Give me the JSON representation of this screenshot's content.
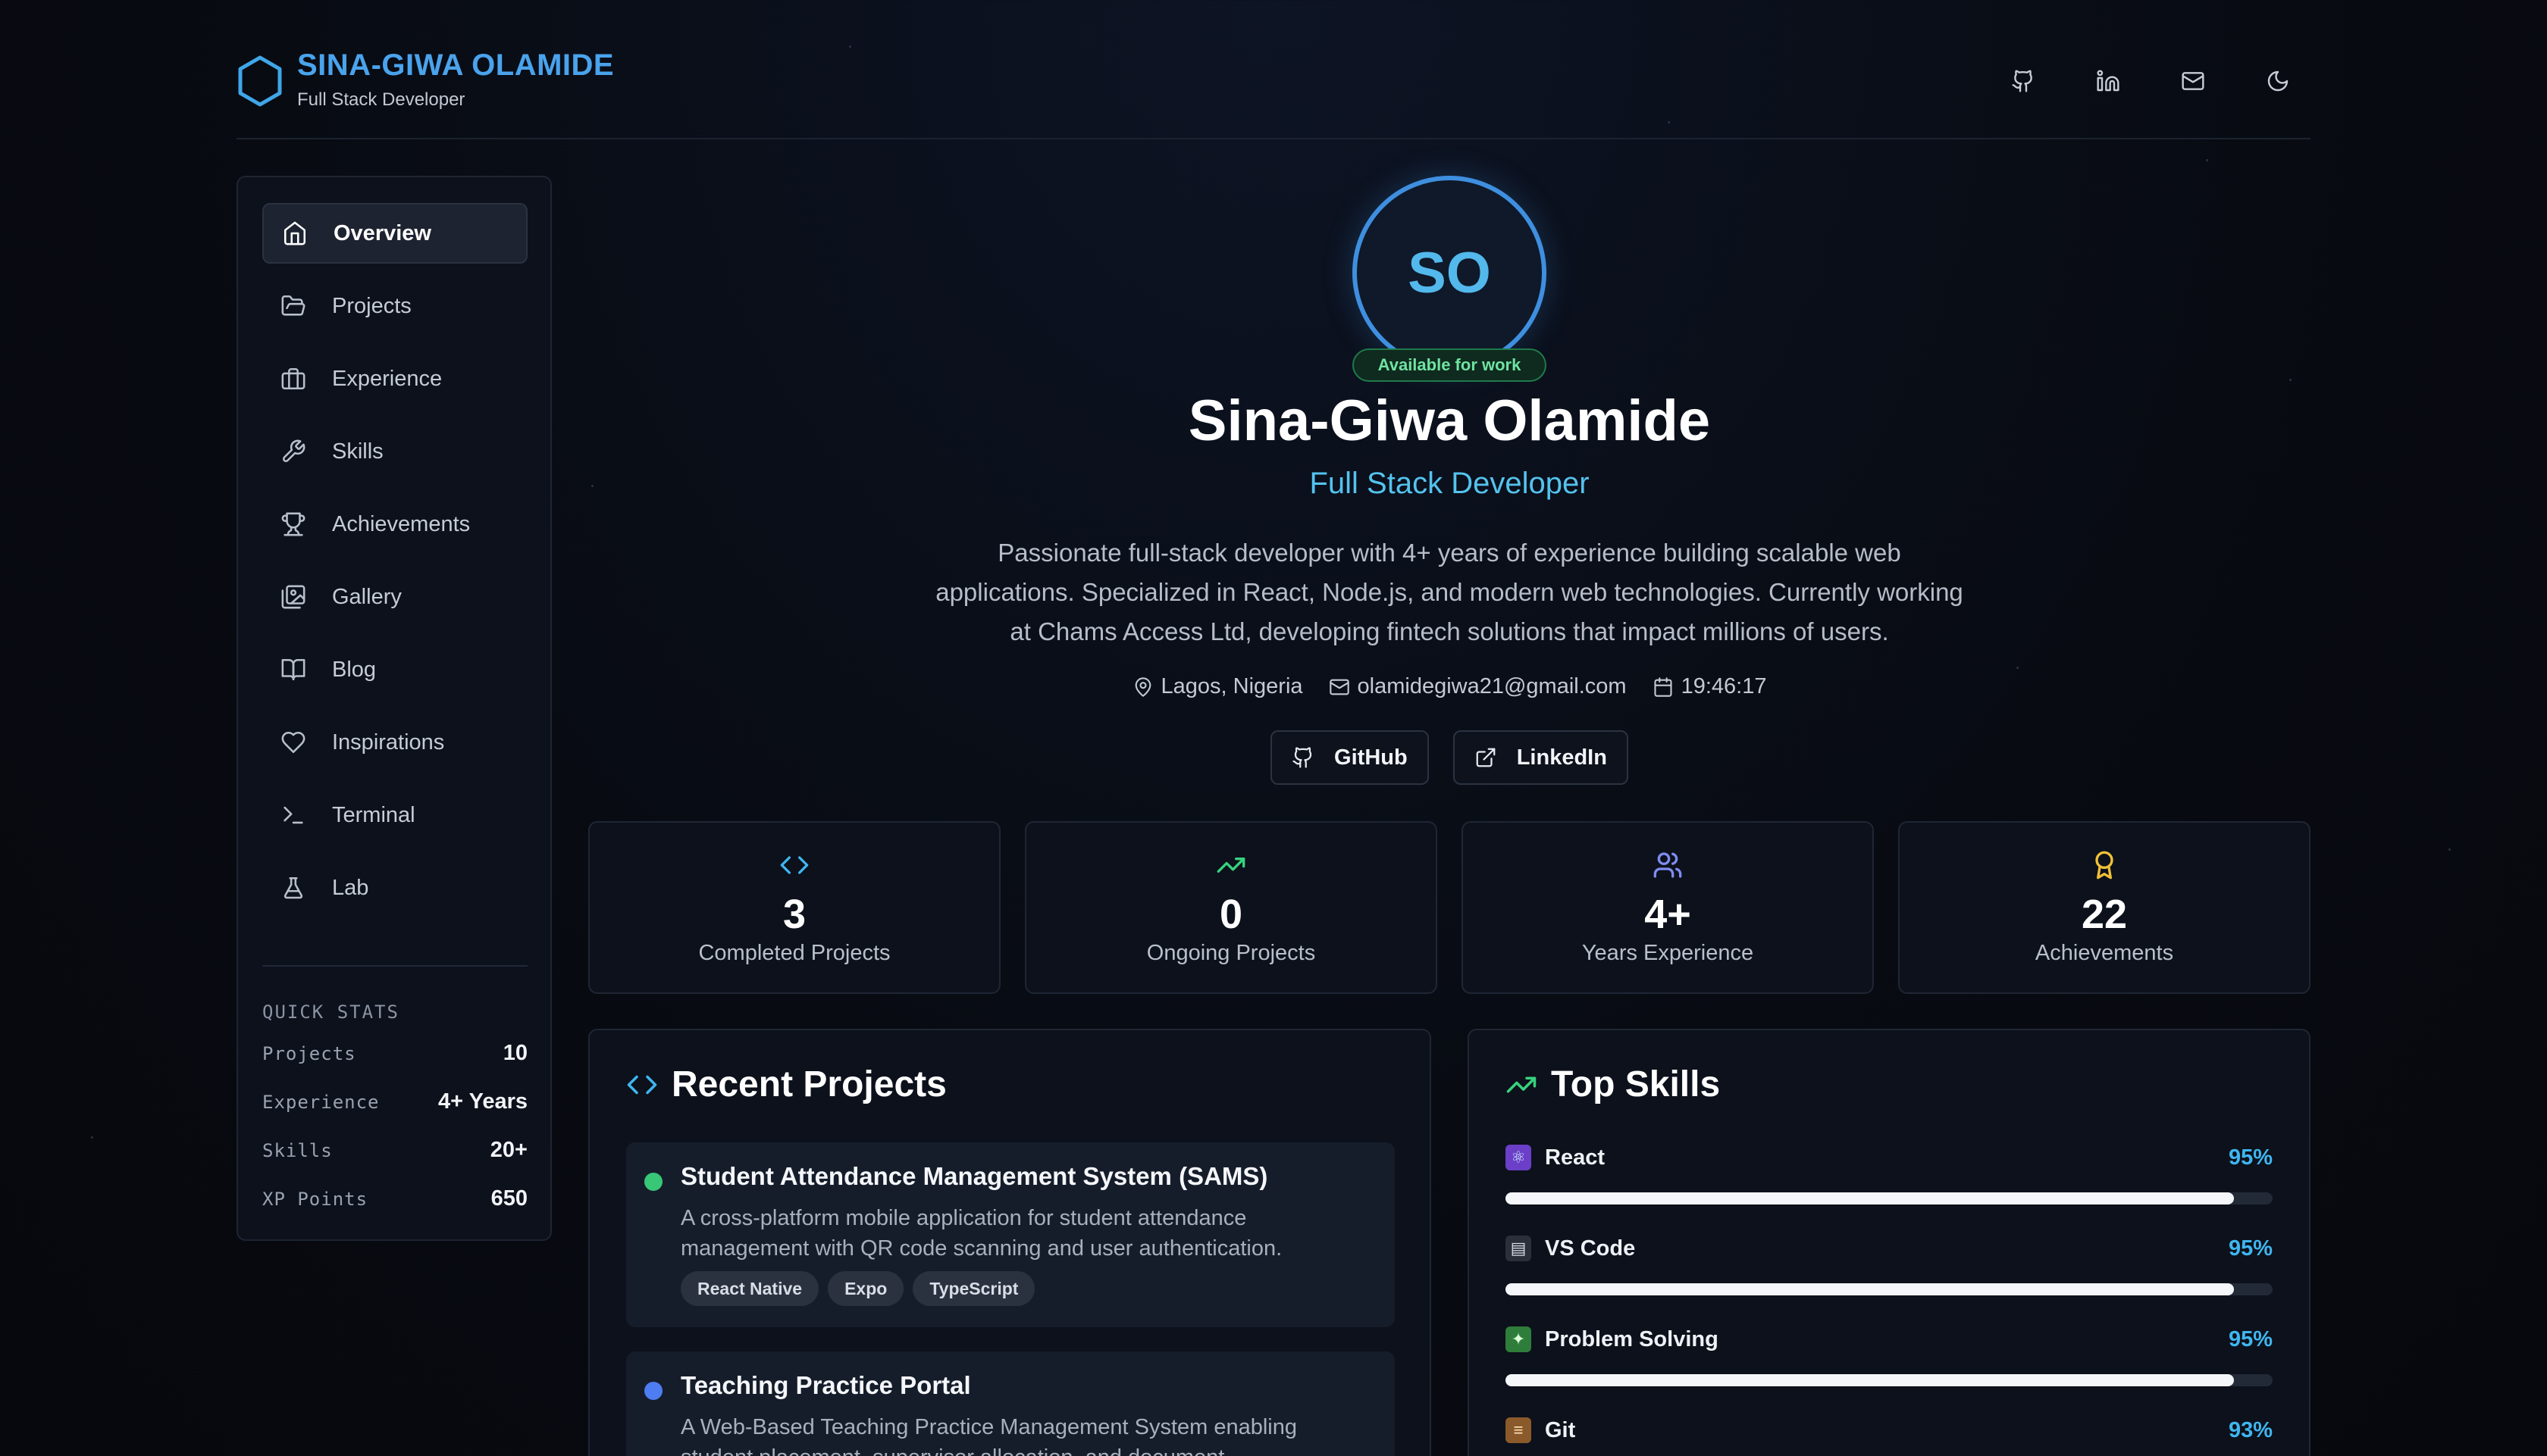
{
  "brand": {
    "name": "SINA-GIWA OLAMIDE",
    "subtitle": "Full Stack Developer"
  },
  "header_icons": [
    "github-icon",
    "linkedin-icon",
    "mail-icon",
    "moon-icon"
  ],
  "sidebar": {
    "items": [
      {
        "label": "Overview",
        "icon": "home-icon",
        "active": true
      },
      {
        "label": "Projects",
        "icon": "folder-icon"
      },
      {
        "label": "Experience",
        "icon": "briefcase-icon"
      },
      {
        "label": "Skills",
        "icon": "wrench-icon"
      },
      {
        "label": "Achievements",
        "icon": "trophy-icon"
      },
      {
        "label": "Gallery",
        "icon": "gallery-icon"
      },
      {
        "label": "Blog",
        "icon": "book-icon"
      },
      {
        "label": "Inspirations",
        "icon": "heart-icon"
      },
      {
        "label": "Terminal",
        "icon": "terminal-icon"
      },
      {
        "label": "Lab",
        "icon": "flask-icon"
      }
    ],
    "quick_stats": {
      "title": "QUICK STATS",
      "rows": [
        {
          "label": "Projects",
          "value": "10"
        },
        {
          "label": "Experience",
          "value": "4+ Years"
        },
        {
          "label": "Skills",
          "value": "20+"
        },
        {
          "label": "XP Points",
          "value": "650"
        }
      ]
    }
  },
  "profile": {
    "initials": "SO",
    "availability": "Available for work",
    "name": "Sina-Giwa Olamide",
    "role": "Full Stack Developer",
    "bio": "Passionate full-stack developer with 4+ years of experience building scalable web applications. Specialized in React, Node.js, and modern web technologies. Currently working at Chams Access Ltd, developing fintech solutions that impact millions of users.",
    "location": "Lagos, Nigeria",
    "email": "olamidegiwa21@gmail.com",
    "time": "19:46:17",
    "buttons": {
      "github": "GitHub",
      "linkedin": "LinkedIn"
    }
  },
  "stats": [
    {
      "value": "3",
      "label": "Completed Projects",
      "icon": "code-icon",
      "color": "#3fb6f0"
    },
    {
      "value": "0",
      "label": "Ongoing Projects",
      "icon": "trending-up-icon",
      "color": "#37d27e"
    },
    {
      "value": "4+",
      "label": "Years Experience",
      "icon": "users-icon",
      "color": "#7f8cf0"
    },
    {
      "value": "22",
      "label": "Achievements",
      "icon": "award-icon",
      "color": "#f2c038"
    }
  ],
  "recent_projects": {
    "title": "Recent Projects",
    "items": [
      {
        "title": "Student Attendance Management System (SAMS)",
        "description": "A cross-platform mobile application for student attendance management with QR code scanning and user authentication.",
        "tags": [
          "React Native",
          "Expo",
          "TypeScript"
        ],
        "status_color": "#37c777"
      },
      {
        "title": "Teaching Practice Portal",
        "description": "A Web-Based Teaching Practice Management System enabling student placement, supervisor allocation, and document",
        "tags": [],
        "status_color": "#4d7df0"
      }
    ]
  },
  "top_skills": {
    "title": "Top Skills",
    "items": [
      {
        "name": "React",
        "percent": 95,
        "percent_label": "95%",
        "emoji": "⚛"
      },
      {
        "name": "VS Code",
        "percent": 95,
        "percent_label": "95%",
        "emoji": "▤"
      },
      {
        "name": "Problem Solving",
        "percent": 95,
        "percent_label": "95%",
        "emoji": "✦"
      },
      {
        "name": "Git",
        "percent": 93,
        "percent_label": "93%",
        "emoji": "≡"
      }
    ]
  }
}
